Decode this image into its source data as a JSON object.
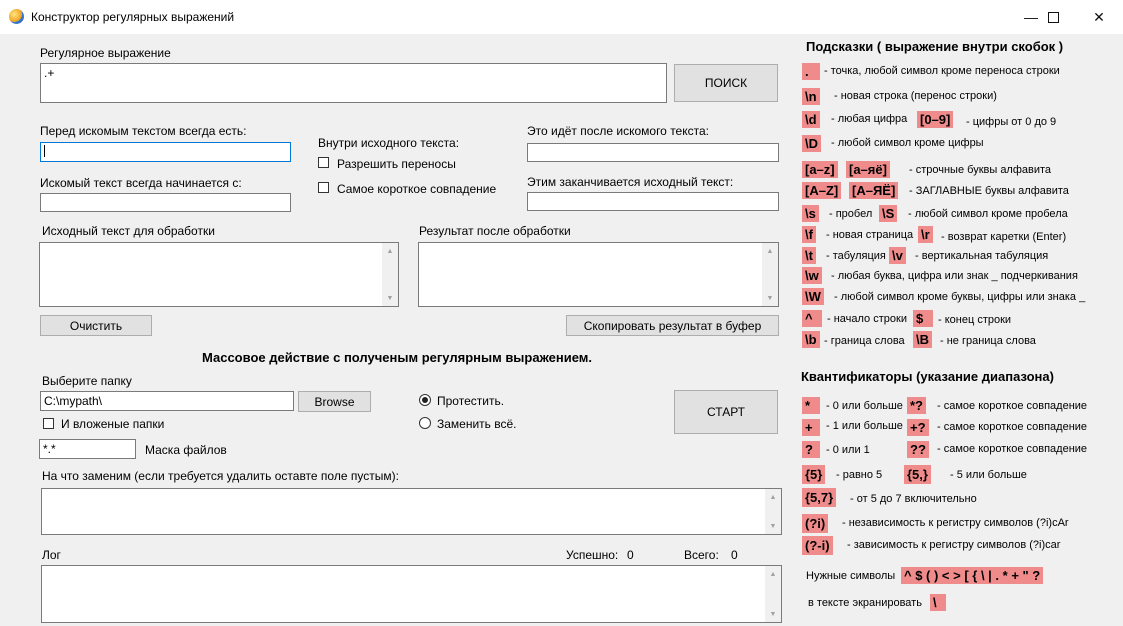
{
  "window": {
    "title": "Конструктор регулярных выражений"
  },
  "regex": {
    "label": "Регулярное выражение",
    "value": ".+",
    "search_button": "ПОИСК"
  },
  "before": {
    "label": "Перед искомым текстом всегда есть:",
    "value": ""
  },
  "starts": {
    "label": "Искомый текст всегда начинается с:",
    "value": ""
  },
  "inside": {
    "label": "Внутри исходного текста:",
    "allow_wrap": "Разрешить переносы",
    "shortest": "Самое короткое совпадение"
  },
  "after": {
    "label": "Это идёт после искомого текста:",
    "value": ""
  },
  "ends": {
    "label": "Этим заканчивается исходный текст:",
    "value": ""
  },
  "source": {
    "label": "Исходный текст для обработки",
    "clear_button": "Очистить"
  },
  "result": {
    "label": "Результат после обработки",
    "copy_button": "Скопировать результат в буфер"
  },
  "mass": {
    "heading": "Массовое действие с полученым регулярным выражением.",
    "folder_label": "Выберите папку",
    "folder_value": "C:\\mypath\\",
    "browse_button": "Browse",
    "subfolders": "И вложеные папки",
    "mask_value": "*.*",
    "mask_label": "Маска файлов",
    "test_radio": "Протестить.",
    "replace_radio": "Заменить всё.",
    "start_button": "СТАРТ",
    "replace_label": "На что заменим (если требуется удалить оставте поле пустым):"
  },
  "log": {
    "label": "Лог",
    "success_label": "Успешно:",
    "success_value": "0",
    "total_label": "Всего:",
    "total_value": "0"
  },
  "hints": {
    "title": "Подсказки ( выражение внутри скобок )",
    "dot": ".",
    "dot_desc": "- точка, любой символ кроме переноса строки",
    "n": "\\n",
    "n_desc": "- новая строка (перенос строки)",
    "d": "\\d",
    "d_desc": "- любая цифра",
    "range09": "[0–9]",
    "range09_desc": "- цифры от 0 до 9",
    "D": "\\D",
    "D_desc": "- любой символ кроме цифры",
    "az": "[a–z]",
    "ayo": "[а–яё]",
    "lower_desc": "- строчные буквы алфавита",
    "AZ": "[A–Z]",
    "AYO": "[А–ЯЁ]",
    "upper_desc": "- ЗАГЛАВНЫЕ буквы алфавита",
    "s": "\\s",
    "s_desc": "- пробел",
    "S": "\\S",
    "S_desc": "- любой символ кроме пробела",
    "f": "\\f",
    "f_desc": "- новая страница",
    "r": "\\r",
    "r_desc": "- возврат каретки (Enter)",
    "t": "\\t",
    "t_desc": "- табуляция",
    "v": "\\v",
    "v_desc": "- вертикальная табуляция",
    "w": "\\w",
    "w_desc": "- любая буква, цифра или знак _ подчеркивания",
    "W": "\\W",
    "W_desc": "- любой символ кроме буквы, цифры или знака _",
    "caret": "^",
    "caret_desc": "- начало строки",
    "dollar": "$",
    "dollar_desc": "- конец строки",
    "b": "\\b",
    "b_desc": "- граница слова",
    "B": "\\B",
    "B_desc": "- не граница слова"
  },
  "quant": {
    "title": "Квантификаторы (указание диапазона)",
    "star": "*",
    "star_desc": "- 0 или больше",
    "star_lazy": "*?",
    "lazy_desc": "- самое короткое совпадение",
    "plus": "+",
    "plus_desc": "- 1 или больше",
    "plus_lazy": "+?",
    "q": "?",
    "q_desc": "- 0 или 1",
    "q_lazy": "??",
    "five": "{5}",
    "five_desc": "- равно 5",
    "five_more": "{5,}",
    "five_more_desc": "- 5 или больше",
    "five_seven": "{5,7}",
    "five_seven_desc": "- от 5 до 7 включительно",
    "ci": "(?i)",
    "ci_desc": "- независимость к регистру символов (?i)cAr",
    "cs": "(?-i)",
    "cs_desc": "- зависимость к регистру символов (?i)car",
    "special_label": "Нужные символы",
    "special": "^ $ ( ) < > [ { \\ |  . * + \"  ?",
    "escape_label": "в тексте экранировать",
    "escape": "\\"
  }
}
